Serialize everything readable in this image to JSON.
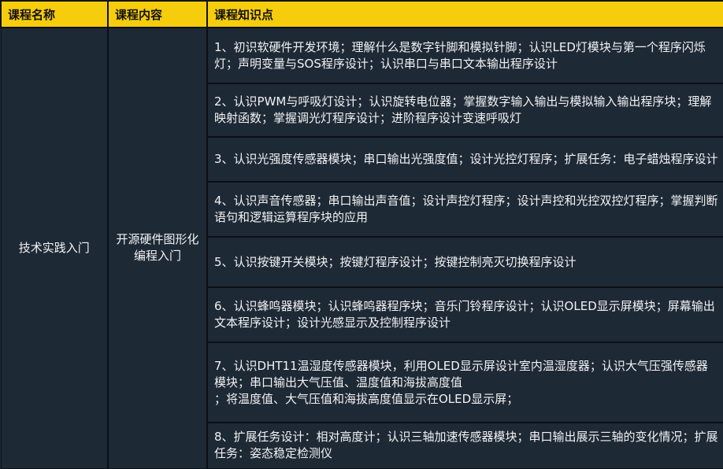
{
  "header": {
    "col1": "课程名称",
    "col2": "课程内容",
    "col3": "课程知识点"
  },
  "course": {
    "name": "技术实践入门",
    "content": "开源硬件图形化编程入门"
  },
  "topics": [
    "1、初识软硬件开发环境；理解什么是数字针脚和模拟针脚；认识LED灯模块与第一个程序闪烁灯；声明变量与SOS程序设计；认识串口与串口文本输出程序设计",
    "2、认识PWM与呼吸灯设计；认识旋转电位器；掌握数字输入输出与模拟输入输出程序块；理解映射函数；掌握调光灯程序设计；进阶程序设计变速呼吸灯",
    "3、认识光强度传感器模块；串口输出光强度值；设计光控灯程序；扩展任务：电子蜡烛程序设计",
    "4、认识声音传感器；串口输出声音值；设计声控灯程序；设计声控和光控双控灯程序；掌握判断语句和逻辑运算程序块的应用",
    "5、认识按键开关模块；按键灯程序设计；按键控制亮灭切换程序设计",
    "6、认识蜂鸣器模块；认识蜂鸣器程序块；音乐门铃程序设计；认识OLED显示屏模块；屏幕输出文本程序设计；设计光感显示及控制程序设计",
    "7、认识DHT11温湿度传感器模块，利用OLED显示屏设计室内温湿度器；认识大气压强传感器模块；串口输出大气压值、温度值和海拔高度值\n；将温度值、大气压值和海拔高度值显示在OLED显示屏；",
    "8、扩展任务设计：相对高度计；认识三轴加速传感器模块；串口输出展示三轴的变化情况；扩展任务：姿态稳定检测仪"
  ]
}
